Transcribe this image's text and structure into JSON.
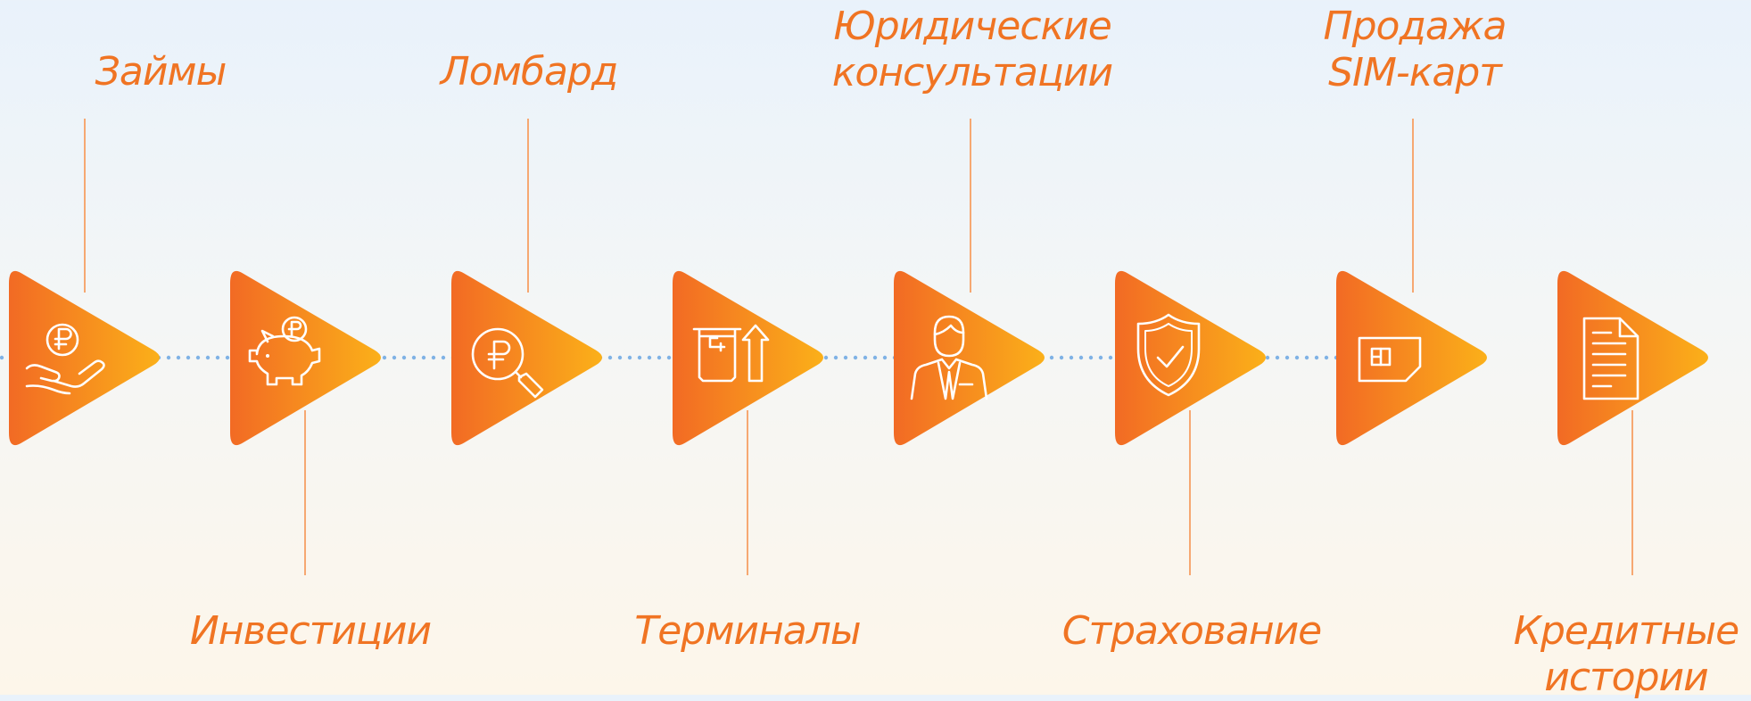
{
  "colors": {
    "accent": "#f07423",
    "gradient_start": "#f26a24",
    "gradient_end": "#fbb019",
    "connector": "#f6a872",
    "dots": "#7fb2e5",
    "icon": "#ffffff"
  },
  "steps": [
    {
      "label": "Займы",
      "icon": "hand-ruble-coin-icon",
      "label_position": "top"
    },
    {
      "label": "Инвестиции",
      "icon": "piggy-bank-icon",
      "label_position": "bottom"
    },
    {
      "label": "Ломбард",
      "icon": "ruble-magnifier-icon",
      "label_position": "top"
    },
    {
      "label": "Терминалы",
      "icon": "terminal-icon",
      "label_position": "bottom"
    },
    {
      "label": "Юридические консультации",
      "icon": "lawyer-icon",
      "label_position": "top"
    },
    {
      "label": "Страхование",
      "icon": "shield-check-icon",
      "label_position": "bottom"
    },
    {
      "label": "Продажа SIM-карт",
      "icon": "sim-card-icon",
      "label_position": "top"
    },
    {
      "label": "Кредитные истории",
      "icon": "document-icon",
      "label_position": "bottom"
    }
  ]
}
